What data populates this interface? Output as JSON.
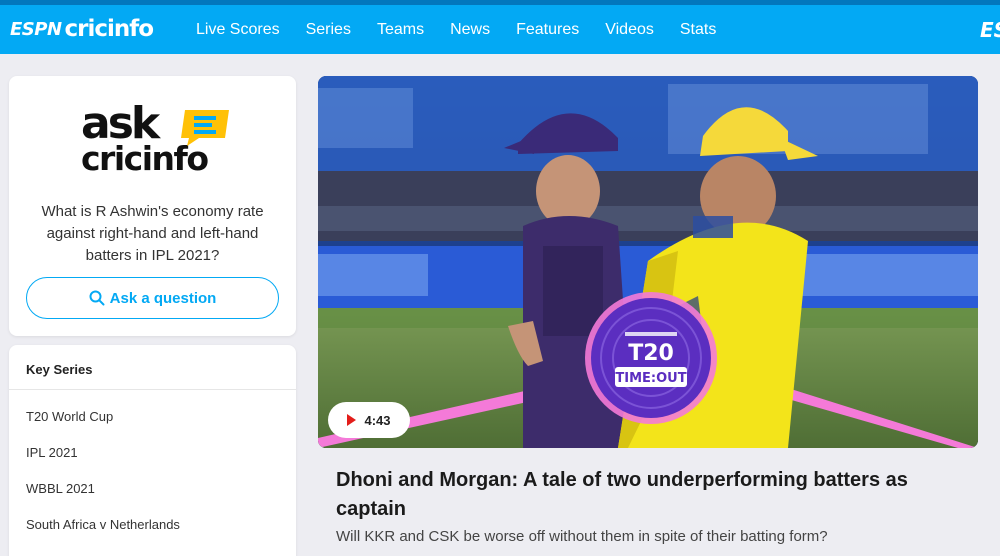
{
  "header": {
    "logo_espn": "ESPN",
    "logo_cric": "cricinfo",
    "nav": [
      "Live Scores",
      "Series",
      "Teams",
      "News",
      "Features",
      "Videos",
      "Stats"
    ]
  },
  "ask_card": {
    "logo_top": "ask",
    "logo_bottom": "cricinfo",
    "question": "What is R Ashwin's economy rate against right-hand and left-hand batters in IPL 2021?",
    "button_label": "Ask a question"
  },
  "key_series": {
    "title": "Key Series",
    "items": [
      "T20 World Cup",
      "IPL 2021",
      "WBBL 2021",
      "South Africa v Netherlands"
    ]
  },
  "hero": {
    "badge_top": "T20",
    "badge_bottom": "TIME:OUT",
    "duration": "4:43"
  },
  "article": {
    "headline": "Dhoni and Morgan: A tale of two underperforming batters as captain",
    "summary": "Will KKR and CSK be worse off without them in spite of their batting form?"
  },
  "colors": {
    "brand": "#03a9f4",
    "brand_dark": "#0277bd",
    "accent_yellow": "#ffc107",
    "play_red": "#e31d1a"
  }
}
